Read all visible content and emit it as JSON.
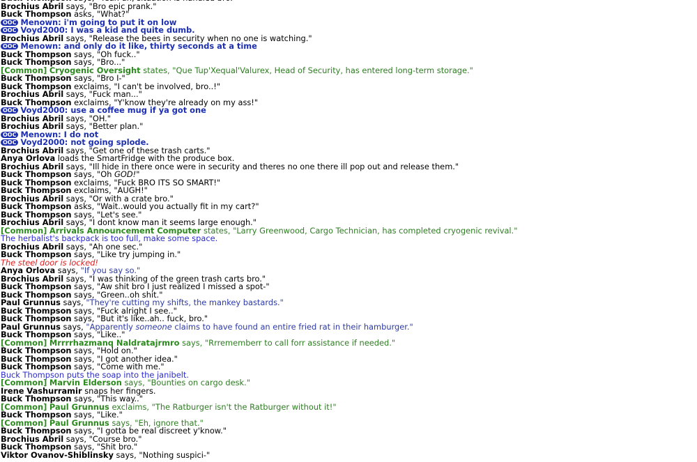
{
  "ooc_tag": "OOC",
  "lines": [
    {
      "type": "say",
      "name": "Buck Thompson",
      "verb": "says,",
      "text": "\"Yeah uh, situation is handled bro.\""
    },
    {
      "type": "say",
      "name": "Brochius Abril",
      "verb": "says,",
      "text": "\"Bro epic prank.\""
    },
    {
      "type": "say",
      "name": "Buck Thompson",
      "verb": "asks,",
      "text": "\"What?\""
    },
    {
      "type": "ooc",
      "name": "Menown:",
      "text": "i'm going to put it on low"
    },
    {
      "type": "ooc",
      "name": "Voyd2000:",
      "text": "I was a kid and quite dumb."
    },
    {
      "type": "say",
      "name": "Brochius Abril",
      "verb": "says,",
      "text": "\"Release the bees in security when no one is watching.\""
    },
    {
      "type": "ooc",
      "name": "Menown:",
      "text": "and only do it like, thirty seconds at a time"
    },
    {
      "type": "say",
      "name": "Buck Thompson",
      "verb": "says,",
      "text": "\"Oh fuck..\""
    },
    {
      "type": "say",
      "name": "Buck Thompson",
      "verb": "says,",
      "text": "\"Bro...\""
    },
    {
      "type": "common",
      "channel": "[Common]",
      "name": "Cryogenic Oversight",
      "verb": "states,",
      "text": "\"Que Tup'Xequal'Valurex, Head of Security, has entered long-term storage.\""
    },
    {
      "type": "say",
      "name": "Buck Thompson",
      "verb": "says,",
      "text": "\"Bro I-\""
    },
    {
      "type": "say",
      "name": "Buck Thompson",
      "verb": "exclaims,",
      "text": "\"I can't be involved, bro..!\""
    },
    {
      "type": "say",
      "name": "Brochius Abril",
      "verb": "says,",
      "text": "\"Fuck man...\""
    },
    {
      "type": "say",
      "name": "Buck Thompson",
      "verb": "exclaims,",
      "text": "\"Y'know they're already on my ass!\""
    },
    {
      "type": "ooc",
      "name": "Voyd2000:",
      "text": "use a coffee mug if ya got one"
    },
    {
      "type": "say",
      "name": "Brochius Abril",
      "verb": "says,",
      "text": "\"OH.\""
    },
    {
      "type": "say",
      "name": "Brochius Abril",
      "verb": "says,",
      "text": "\"Better plan.\""
    },
    {
      "type": "ooc",
      "name": "Menown:",
      "text": "I do not"
    },
    {
      "type": "ooc",
      "name": "Voyd2000:",
      "text": "not going splode."
    },
    {
      "type": "say",
      "name": "Brochius Abril",
      "verb": "says,",
      "text": "\"Get one of these trash carts.\""
    },
    {
      "type": "emote",
      "name": "Anya Orlova",
      "text": "loads the SmartFridge with the produce box."
    },
    {
      "type": "say",
      "name": "Brochius Abril",
      "verb": "says,",
      "text": "\"Ill hide in there once were in security and theres no one there ill pop out and release them.\""
    },
    {
      "type": "say_emph",
      "name": "Buck Thompson",
      "verb": "says,",
      "pre": "\"Oh ",
      "emph": "GOD!",
      "post": "\""
    },
    {
      "type": "say",
      "name": "Buck Thompson",
      "verb": "exclaims,",
      "text": "\"Fuck BRO ITS SO SMART!\""
    },
    {
      "type": "say",
      "name": "Buck Thompson",
      "verb": "exclaims,",
      "text": "\"AUGH!\""
    },
    {
      "type": "say",
      "name": "Brochius Abril",
      "verb": "says,",
      "text": "\"Or with a crate bro.\""
    },
    {
      "type": "say",
      "name": "Buck Thompson",
      "verb": "asks,",
      "text": "\"Wait..would you actually fit in my cart?\""
    },
    {
      "type": "say",
      "name": "Buck Thompson",
      "verb": "says,",
      "text": "\"Let's see.\""
    },
    {
      "type": "say",
      "name": "Brochius Abril",
      "verb": "says,",
      "text": "\"I dont know man it seems large enough.\""
    },
    {
      "type": "common",
      "channel": "[Common]",
      "name": "Arrivals Announcement Computer",
      "verb": "states,",
      "text": "\"Larry Greenwood, Cargo Technician, has completed cryogenic revival.\""
    },
    {
      "type": "notice",
      "text": "The herbalist's backpack is too full, make some space."
    },
    {
      "type": "say",
      "name": "Brochius Abril",
      "verb": "says,",
      "text": "\"Ah one sec.\""
    },
    {
      "type": "say",
      "name": "Buck Thompson",
      "verb": "says,",
      "text": "\"Like try jumping in.\""
    },
    {
      "type": "warning",
      "text": "The steel door is locked!"
    },
    {
      "type": "npc",
      "name": "Anya Orlova",
      "verb": "says,",
      "text": "\"If you say so.\""
    },
    {
      "type": "say",
      "name": "Brochius Abril",
      "verb": "says,",
      "text": "\"I was thinking of the green trash carts bro.\""
    },
    {
      "type": "say",
      "name": "Buck Thompson",
      "verb": "says,",
      "text": "\"Aw shit bro I just realized I missed a spot-\""
    },
    {
      "type": "say",
      "name": "Buck Thompson",
      "verb": "says,",
      "text": "\"Green..oh shit.\""
    },
    {
      "type": "npc",
      "name": "Paul Grunnus",
      "verb": "says,",
      "text": "\"They're cutting my shifts, the mankey bastards.\""
    },
    {
      "type": "say",
      "name": "Buck Thompson",
      "verb": "says,",
      "text": "\"Fuck alright I see..\""
    },
    {
      "type": "say",
      "name": "Buck Thompson",
      "verb": "says,",
      "text": "\"But it's like..ah.. fuck, bro.\""
    },
    {
      "type": "npc_emph",
      "name": "Paul Grunnus",
      "verb": "says,",
      "pre": "\"Apparently ",
      "emph": "someone",
      "post": " claims to have found an entire fried rat in their hamburger.\""
    },
    {
      "type": "say",
      "name": "Buck Thompson",
      "verb": "says,",
      "text": "\"Like..\""
    },
    {
      "type": "common",
      "channel": "[Common]",
      "name": "Mrrrrhazmanq Naldratajrmro",
      "verb": "says,",
      "text": "\"Rrrememberr to call forr assistance if needed.\""
    },
    {
      "type": "say",
      "name": "Buck Thompson",
      "verb": "says,",
      "text": "\"Hold on.\""
    },
    {
      "type": "say",
      "name": "Buck Thompson",
      "verb": "says,",
      "text": "\"I got another idea.\""
    },
    {
      "type": "say",
      "name": "Buck Thompson",
      "verb": "says,",
      "text": "\"Come with me.\""
    },
    {
      "type": "notice",
      "text": "Buck Thompson puts the soap into the janibelt."
    },
    {
      "type": "common",
      "channel": "[Common]",
      "name": "Marvin Elderson",
      "verb": "says,",
      "text": "\"Bounties on cargo desk.\""
    },
    {
      "type": "emote",
      "name": "Irene Vashurramir",
      "text": "snaps her fingers."
    },
    {
      "type": "say",
      "name": "Buck Thompson",
      "verb": "says,",
      "text": "\"This way..\""
    },
    {
      "type": "common",
      "channel": "[Common]",
      "name": "Paul Grunnus",
      "verb": "exclaims,",
      "text": "\"The Ratburger isn't the Ratburger without it!\""
    },
    {
      "type": "say",
      "name": "Buck Thompson",
      "verb": "says,",
      "text": "\"Like.\""
    },
    {
      "type": "common",
      "channel": "[Common]",
      "name": "Paul Grunnus",
      "verb": "says,",
      "text": "\"Eh, ignore that.\""
    },
    {
      "type": "say",
      "name": "Buck Thompson",
      "verb": "says,",
      "text": "\"I gotta be real discreet y'know.\""
    },
    {
      "type": "say",
      "name": "Brochius Abril",
      "verb": "says,",
      "text": "\"Course bro.\""
    },
    {
      "type": "say",
      "name": "Buck Thompson",
      "verb": "says,",
      "text": "\"Shit bro.\""
    },
    {
      "type": "say",
      "name": "Viktor Ovanov-Shiblinsky",
      "verb": "says,",
      "text": "\"Nothing suspici-\""
    }
  ]
}
